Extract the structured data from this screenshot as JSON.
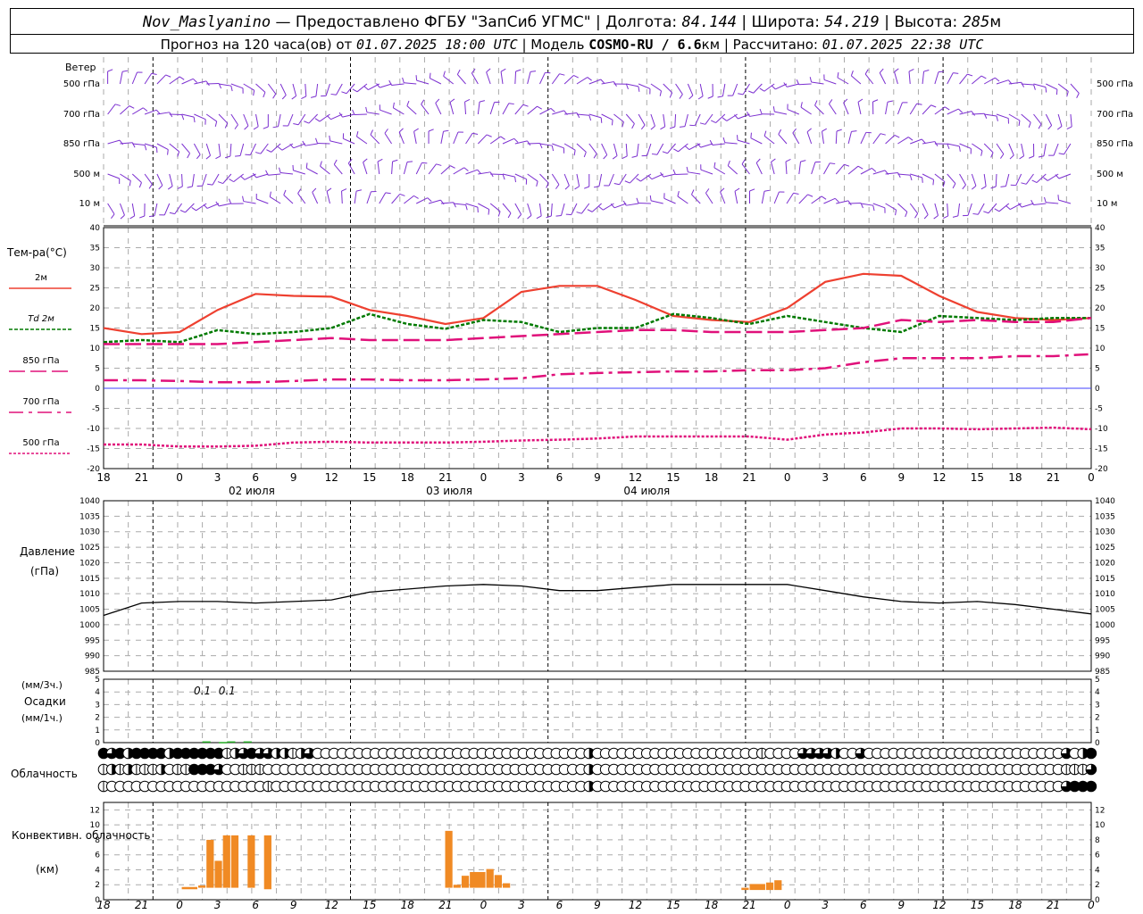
{
  "header": {
    "station": "Nov_Maslyanino",
    "provider": "— Предоставлено ФГБУ \"ЗапСиб УГМС\"",
    "lon_label": "Долгота:",
    "lon_value": "84.144",
    "lat_label": "Широта:",
    "lat_value": "54.219",
    "alt_label": "Высота:",
    "alt_value": "285",
    "alt_unit": "м",
    "forecast_prefix": "Прогноз на 120 часа(ов) от",
    "forecast_start": "01.07.2025 18:00 UTC",
    "model_label": "Модель",
    "model_name": "COSMO-RU / 6.6",
    "model_unit": "км",
    "computed_label": "Рассчитано:",
    "computed_time": "01.07.2025 22:38 UTC"
  },
  "colors": {
    "wind": "#7b2fd0",
    "t2m": "#ee4030",
    "td2m": "#007a00",
    "t850": "#e0107a",
    "t700": "#e0107a",
    "t500": "#e0107a",
    "zero_line": "#4040ff",
    "pressure": "#000000",
    "precip": "#22aa22",
    "convective": "#f08a24",
    "grid": "#aaaaaa"
  },
  "chart_data": [
    {
      "type": "wind-barbs",
      "panel_label": "Ветер",
      "levels": [
        "500 гПа",
        "700 гПа",
        "850 гПа",
        "500 м",
        "10   м"
      ]
    },
    {
      "type": "line",
      "ylabel": "Тем-ра(°C)",
      "ylim": [
        -20,
        40
      ],
      "yticks": [
        -20,
        -15,
        -10,
        -5,
        0,
        5,
        10,
        15,
        20,
        25,
        30,
        35,
        40
      ],
      "x_hours": [
        0,
        6,
        12,
        18,
        24,
        30,
        36,
        42,
        48,
        54,
        60,
        66,
        72,
        78,
        84,
        90,
        96,
        102,
        108,
        114,
        120
      ],
      "x_tick_labels": [
        "18",
        "21",
        "0",
        "3",
        "6",
        "9",
        "12",
        "15",
        "18",
        "21",
        "0",
        "3",
        "6",
        "9",
        "12",
        "15",
        "18",
        "21",
        "0",
        "3",
        "6",
        "9",
        "12",
        "15",
        "18",
        "21",
        "0"
      ],
      "dates": [
        {
          "label": "02 июля",
          "hour": 18
        },
        {
          "label": "03 июля",
          "hour": 42
        },
        {
          "label": "04 июля",
          "hour": 66
        }
      ],
      "series": [
        {
          "name": "2м",
          "values": [
            15,
            13.5,
            14,
            19.5,
            23.5,
            23,
            22.8,
            19.5,
            18,
            16,
            17.5,
            24,
            25.5,
            25.5,
            22,
            18,
            17,
            16.5,
            20,
            26.5,
            28.5,
            28,
            23,
            19,
            17.5,
            17,
            17.5
          ]
        },
        {
          "name": "Td 2м",
          "values": [
            11.5,
            12,
            11.5,
            14.5,
            13.5,
            14,
            15,
            18.5,
            16,
            14.8,
            17,
            16.5,
            14,
            15,
            15,
            18.5,
            17.5,
            16,
            18,
            16.5,
            15,
            14,
            18,
            17.5,
            17,
            17.5,
            17.5
          ]
        },
        {
          "name": "850 гПа",
          "values": [
            11,
            11,
            11,
            11,
            11.5,
            12,
            12.5,
            12,
            12,
            12,
            12.5,
            13,
            13.5,
            14,
            14.5,
            14.5,
            14,
            14,
            14,
            14.5,
            15,
            17,
            16.5,
            17,
            16.5,
            16.5,
            17.5
          ]
        },
        {
          "name": "700 гПа",
          "values": [
            2,
            2,
            1.8,
            1.5,
            1.5,
            1.8,
            2.2,
            2.2,
            2,
            2,
            2.2,
            2.5,
            3.5,
            3.8,
            4,
            4.2,
            4.2,
            4.5,
            4.5,
            5,
            6.5,
            7.5,
            7.5,
            7.5,
            8,
            8,
            8.5
          ]
        },
        {
          "name": "500 гПа",
          "values": [
            -14,
            -14,
            -14.5,
            -14.5,
            -14.3,
            -13.5,
            -13.3,
            -13.5,
            -13.5,
            -13.5,
            -13.3,
            -13,
            -12.8,
            -12.5,
            -12,
            -12,
            -12,
            -12,
            -12.8,
            -11.5,
            -11,
            -10,
            -10,
            -10.2,
            -10,
            -9.8,
            -10.2
          ]
        }
      ]
    },
    {
      "type": "line",
      "title": "Давление",
      "ylabel": "(гПа)",
      "ylim": [
        985,
        1040
      ],
      "yticks": [
        985,
        990,
        995,
        1000,
        1005,
        1010,
        1015,
        1020,
        1025,
        1030,
        1035,
        1040
      ],
      "series": [
        {
          "values": [
            1003,
            1007,
            1007.5,
            1007.5,
            1007,
            1007.5,
            1008,
            1010.5,
            1011.5,
            1012.5,
            1013,
            1012.5,
            1011,
            1011,
            1012,
            1013,
            1013,
            1013,
            1013,
            1011,
            1009,
            1007.5,
            1007,
            1007.5,
            1006.5,
            1005,
            1003.5
          ]
        }
      ]
    },
    {
      "type": "bar",
      "title": "Осадки",
      "ylabel_top": "(мм/3ч.)",
      "ylabel_bottom": "(мм/1ч.)",
      "ylim": [
        0,
        5
      ],
      "yticks": [
        0,
        1,
        2,
        3,
        4,
        5
      ],
      "labels": [
        {
          "text": "0.1",
          "hour": 12
        },
        {
          "text": "0.1",
          "hour": 15
        }
      ],
      "bars": [
        {
          "start": 12,
          "end": 13,
          "value": 0.1
        },
        {
          "start": 14,
          "end": 15,
          "value": 0.05
        },
        {
          "start": 15,
          "end": 16,
          "value": 0.1
        },
        {
          "start": 17,
          "end": 18,
          "value": 0.1
        }
      ]
    },
    {
      "type": "cloud-symbols",
      "label": "Облачность",
      "rows": [
        [
          4,
          3,
          4,
          2,
          4,
          4,
          4,
          4,
          2,
          4,
          4,
          4,
          4,
          4,
          4,
          1,
          2,
          3,
          4,
          3,
          3,
          2,
          2,
          1,
          2,
          3,
          0,
          0,
          0,
          0,
          0,
          0,
          0,
          0,
          0,
          0,
          0,
          0,
          0,
          0,
          0,
          0,
          0,
          0,
          0,
          0,
          0,
          0,
          0,
          0,
          0,
          0,
          0,
          0,
          0,
          0,
          0,
          0,
          0,
          2,
          0,
          0,
          0,
          0,
          0,
          0,
          0,
          0,
          0,
          0,
          0,
          0,
          0,
          0,
          0,
          0,
          0,
          0,
          0,
          0,
          1,
          0,
          0,
          0,
          0,
          3,
          3,
          3,
          3,
          2,
          0,
          0,
          3,
          0,
          0,
          0,
          0,
          0,
          0,
          0,
          0,
          0,
          0,
          0,
          0,
          0,
          0,
          0,
          0,
          0,
          0,
          0,
          0,
          0,
          0,
          0,
          0,
          3,
          0,
          2,
          4
        ],
        [
          1,
          2,
          1,
          2,
          1,
          1,
          1,
          2,
          0,
          1,
          1,
          4,
          4,
          4,
          3,
          0,
          0,
          1,
          1,
          1,
          0,
          0,
          0,
          0,
          0,
          0,
          0,
          0,
          0,
          0,
          0,
          0,
          0,
          0,
          0,
          0,
          0,
          0,
          0,
          0,
          0,
          0,
          0,
          0,
          0,
          0,
          0,
          0,
          0,
          0,
          0,
          0,
          0,
          0,
          0,
          0,
          0,
          0,
          0,
          2,
          0,
          0,
          0,
          0,
          0,
          0,
          0,
          0,
          0,
          0,
          0,
          0,
          0,
          0,
          0,
          0,
          0,
          0,
          0,
          0,
          0,
          0,
          0,
          0,
          0,
          0,
          0,
          0,
          0,
          0,
          0,
          0,
          0,
          0,
          0,
          0,
          0,
          0,
          0,
          0,
          0,
          0,
          0,
          0,
          0,
          0,
          0,
          0,
          0,
          0,
          0,
          0,
          0,
          0,
          0,
          0,
          0,
          1,
          1,
          1,
          3
        ],
        [
          1,
          0,
          0,
          0,
          0,
          0,
          0,
          0,
          0,
          0,
          0,
          0,
          0,
          0,
          0,
          0,
          0,
          0,
          0,
          0,
          1,
          0,
          0,
          0,
          0,
          0,
          0,
          0,
          0,
          0,
          0,
          0,
          0,
          0,
          0,
          0,
          0,
          0,
          0,
          0,
          0,
          0,
          0,
          0,
          0,
          0,
          0,
          0,
          0,
          0,
          0,
          0,
          0,
          0,
          0,
          0,
          0,
          0,
          0,
          2,
          0,
          0,
          0,
          0,
          0,
          0,
          0,
          0,
          0,
          0,
          0,
          0,
          0,
          0,
          0,
          0,
          0,
          0,
          0,
          0,
          0,
          0,
          0,
          0,
          0,
          0,
          0,
          0,
          0,
          0,
          0,
          0,
          0,
          0,
          0,
          0,
          0,
          0,
          0,
          0,
          0,
          0,
          0,
          0,
          0,
          0,
          0,
          0,
          0,
          0,
          0,
          0,
          0,
          0,
          0,
          0,
          0,
          3,
          4,
          4,
          4
        ]
      ]
    },
    {
      "type": "bar",
      "title": "Конвективн. облачность",
      "ylabel": "(км)",
      "ylim": [
        0,
        13
      ],
      "yticks": [
        0,
        2,
        4,
        6,
        8,
        10,
        12
      ],
      "bars": [
        {
          "start": 9.5,
          "end": 11.5,
          "bottom": 1.4,
          "top": 1.7
        },
        {
          "start": 11.5,
          "end": 12.5,
          "bottom": 1.6,
          "top": 1.9
        },
        {
          "start": 12.5,
          "end": 13.5,
          "bottom": 1.6,
          "top": 8.0
        },
        {
          "start": 13.5,
          "end": 14.5,
          "bottom": 1.6,
          "top": 5.2
        },
        {
          "start": 14.5,
          "end": 15.5,
          "bottom": 1.6,
          "top": 8.6
        },
        {
          "start": 15.5,
          "end": 16.5,
          "bottom": 1.6,
          "top": 8.6
        },
        {
          "start": 17.5,
          "end": 18.5,
          "bottom": 1.6,
          "top": 8.6
        },
        {
          "start": 19.5,
          "end": 20.5,
          "bottom": 1.4,
          "top": 8.6
        },
        {
          "start": 41.5,
          "end": 42.5,
          "bottom": 1.6,
          "top": 9.2
        },
        {
          "start": 42.5,
          "end": 43.5,
          "bottom": 1.6,
          "top": 2.0
        },
        {
          "start": 43.5,
          "end": 44.5,
          "bottom": 1.6,
          "top": 3.2
        },
        {
          "start": 44.5,
          "end": 46.5,
          "bottom": 1.6,
          "top": 3.7
        },
        {
          "start": 46.5,
          "end": 47.5,
          "bottom": 1.6,
          "top": 4.1
        },
        {
          "start": 47.5,
          "end": 48.5,
          "bottom": 1.6,
          "top": 3.3
        },
        {
          "start": 48.5,
          "end": 49.5,
          "bottom": 1.6,
          "top": 2.2
        },
        {
          "start": 77.5,
          "end": 78.5,
          "bottom": 1.3,
          "top": 1.6
        },
        {
          "start": 78.5,
          "end": 80.5,
          "bottom": 1.3,
          "top": 2.1
        },
        {
          "start": 80.5,
          "end": 81.5,
          "bottom": 1.3,
          "top": 2.3
        },
        {
          "start": 81.5,
          "end": 82.5,
          "bottom": 1.3,
          "top": 2.6
        }
      ]
    }
  ]
}
